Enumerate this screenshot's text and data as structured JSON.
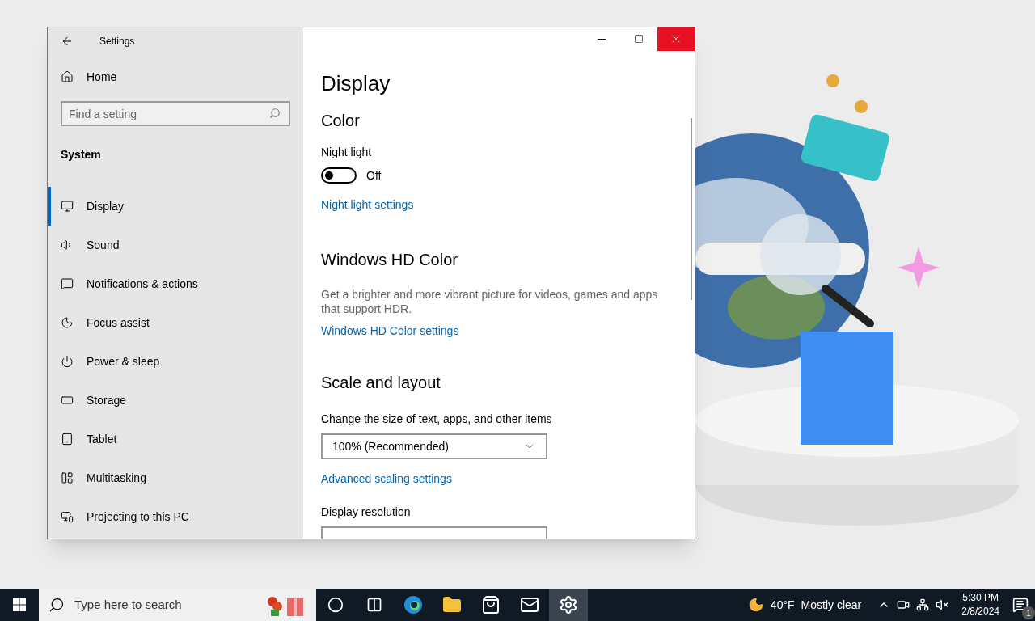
{
  "window": {
    "title": "Settings"
  },
  "sidebar": {
    "home": "Home",
    "search": {
      "placeholder": "Find a setting"
    },
    "section": "System",
    "items": [
      {
        "label": "Display",
        "selected": true
      },
      {
        "label": "Sound",
        "selected": false
      },
      {
        "label": "Notifications & actions",
        "selected": false
      },
      {
        "label": "Focus assist",
        "selected": false
      },
      {
        "label": "Power & sleep",
        "selected": false
      },
      {
        "label": "Storage",
        "selected": false
      },
      {
        "label": "Tablet",
        "selected": false
      },
      {
        "label": "Multitasking",
        "selected": false
      },
      {
        "label": "Projecting to this PC",
        "selected": false
      }
    ]
  },
  "content": {
    "title": "Display",
    "color": {
      "heading": "Color",
      "night_light": {
        "label": "Night light",
        "on": false,
        "state_text": "Off"
      },
      "link": "Night light settings"
    },
    "hd_color": {
      "heading": "Windows HD Color",
      "description": "Get a brighter and more vibrant picture for videos, games and apps that support HDR.",
      "link": "Windows HD Color settings"
    },
    "scale": {
      "heading": "Scale and layout",
      "size_label": "Change the size of text, apps, and other items",
      "size_value": "100% (Recommended)",
      "link": "Advanced scaling settings",
      "resolution_label": "Display resolution"
    }
  },
  "taskbar": {
    "search_placeholder": "Type here to search",
    "apps": [
      {
        "selected": false
      },
      {
        "selected": false
      },
      {
        "selected": false
      },
      {
        "selected": false
      },
      {
        "selected": false
      },
      {
        "selected": false
      },
      {
        "selected": true
      }
    ],
    "temperature": "40°F",
    "weather": "Mostly clear",
    "time": "5:30 PM",
    "date": "2/8/2024",
    "notifications": "1"
  }
}
